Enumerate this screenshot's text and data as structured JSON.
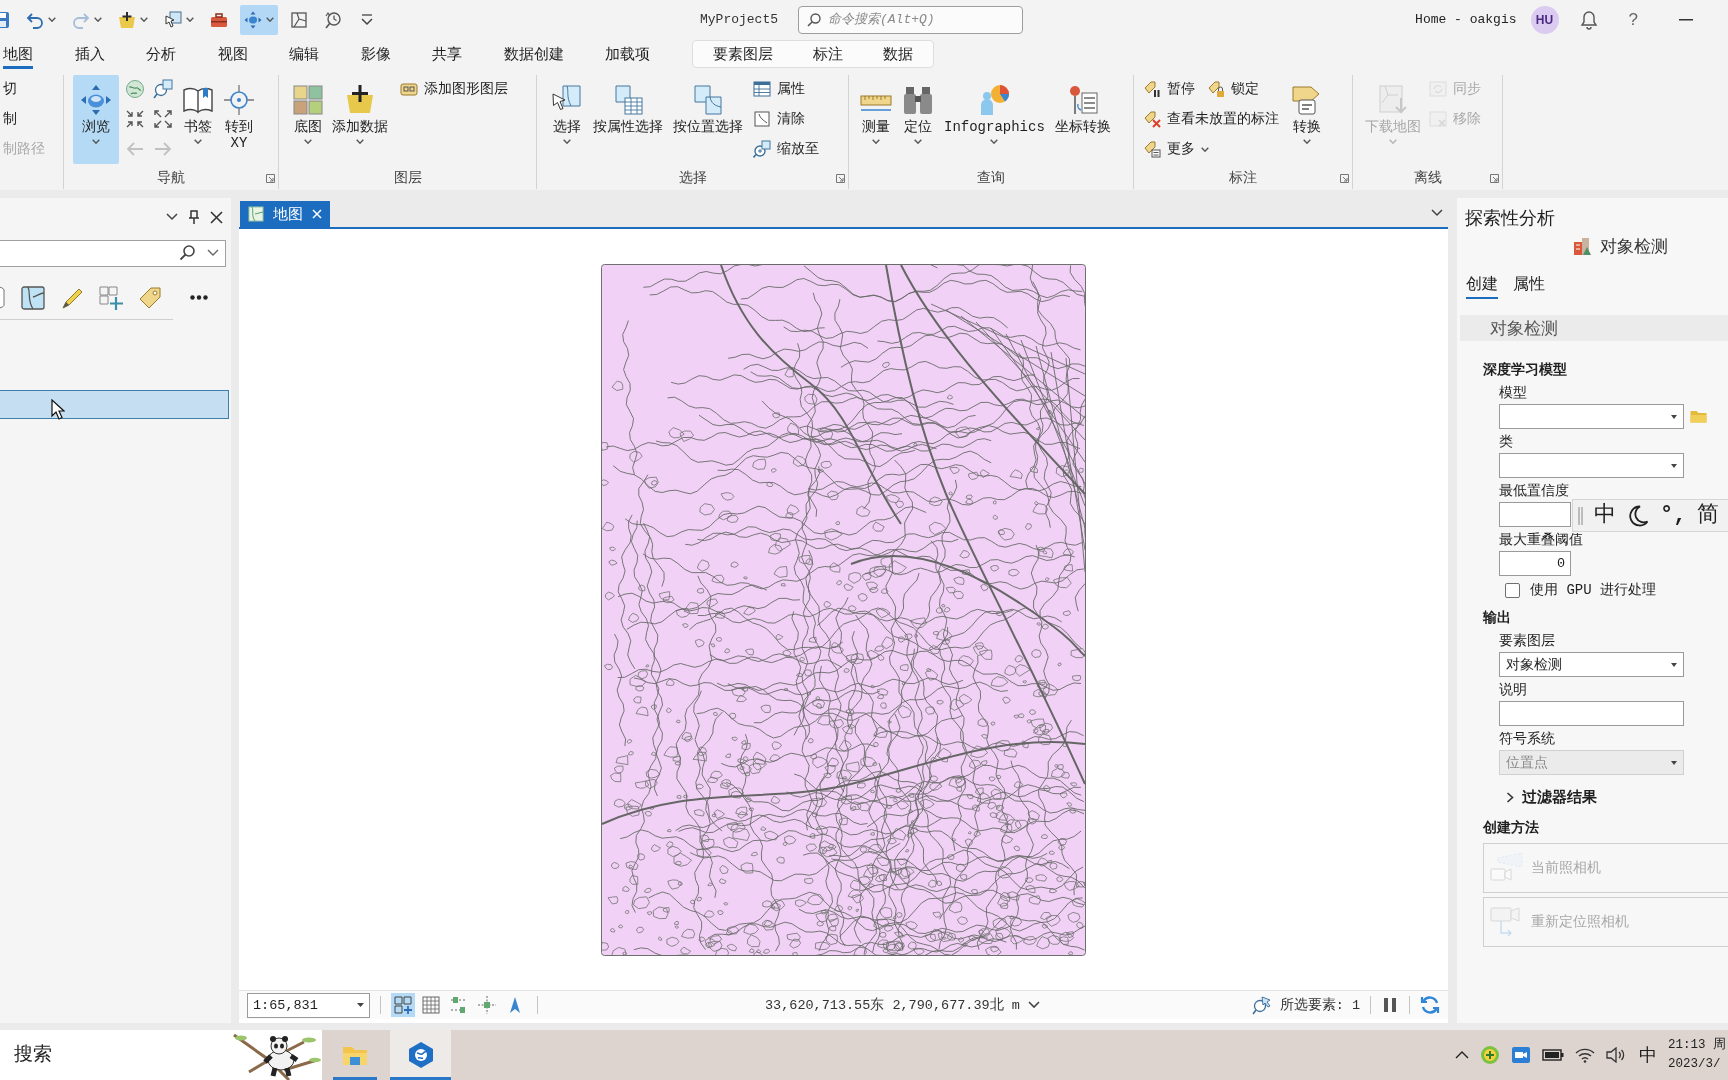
{
  "window": {
    "title": "MyProject5"
  },
  "quick_access": [
    {
      "selected": false,
      "disabled": false,
      "menu": false
    },
    {
      "selected": false,
      "disabled": false,
      "menu": true
    },
    {
      "selected": false,
      "disabled": true,
      "menu": true
    },
    {
      "selected": false,
      "disabled": false,
      "menu": true
    },
    {
      "selected": false,
      "disabled": false,
      "menu": true
    },
    {
      "selected": false,
      "disabled": false,
      "menu": false
    },
    {
      "selected": true,
      "disabled": false,
      "menu": true
    },
    {
      "selected": false,
      "disabled": false,
      "menu": false
    },
    {
      "selected": false,
      "disabled": false,
      "menu": false
    },
    {
      "selected": false,
      "disabled": false,
      "menu": false
    }
  ],
  "command_search": {
    "placeholder": "命令搜索(Alt+Q)"
  },
  "account": {
    "portal": "Home - oakgis",
    "initials": "HU",
    "help": "?"
  },
  "ribbon_tabs": [
    {
      "label": "地图",
      "selected": true
    },
    {
      "label": "插入",
      "selected": false
    },
    {
      "label": "分析",
      "selected": false
    },
    {
      "label": "视图",
      "selected": false
    },
    {
      "label": "编辑",
      "selected": false
    },
    {
      "label": "影像",
      "selected": false
    },
    {
      "label": "共享",
      "selected": false
    },
    {
      "label": "数据创建",
      "selected": false
    },
    {
      "label": "加载项",
      "selected": false
    }
  ],
  "contextual_tabs": [
    {
      "label": "要素图层",
      "selected": false
    },
    {
      "label": "标注",
      "selected": false
    },
    {
      "label": "数据",
      "selected": false
    }
  ],
  "ribbon": {
    "clipboard": [
      {
        "label": "切",
        "disabled": false
      },
      {
        "label": "制",
        "disabled": false
      },
      {
        "label": "制路径",
        "disabled": true
      }
    ],
    "navigate": {
      "label": "导航",
      "explore": {
        "label": "浏览",
        "selected": true
      },
      "tools": [
        {
          "disabled": false
        },
        {
          "disabled": false
        },
        {
          "disabled": false
        },
        {
          "disabled": false
        },
        {
          "disabled": true
        },
        {
          "disabled": true
        }
      ],
      "bookmarks": "书签",
      "go_to_xy": "转到 XY"
    },
    "layer": {
      "label": "图层",
      "basemap": "底图",
      "add_data": "添加数据",
      "add_graphics_layer": "添加图形图层"
    },
    "selection": {
      "label": "选择",
      "large": [
        "选择",
        "按属性选择",
        "按位置选择"
      ],
      "small": [
        "属性",
        "清除",
        "缩放至"
      ]
    },
    "inquiry": {
      "label": "查询",
      "large": [
        "测量",
        "定位",
        "Infographics",
        "坐标转换"
      ]
    },
    "labeling": {
      "label": "标注",
      "small": [
        "暂停",
        "锁定",
        "查看未放置的标注",
        "更多"
      ],
      "convert": "转换"
    },
    "offline": {
      "label": "离线",
      "download": {
        "label": "下载地图",
        "disabled": true
      },
      "small": [
        {
          "label": "同步",
          "disabled": true
        },
        {
          "label": "移除",
          "disabled": true
        }
      ]
    }
  },
  "contents_pane": {
    "rows": [
      {
        "selected": true
      }
    ]
  },
  "map_view": {
    "tab": {
      "label": "地图",
      "selected": true
    },
    "scale": "1:65,831",
    "tools": [
      {
        "selected": true
      },
      {
        "selected": false
      },
      {
        "selected": false
      },
      {
        "selected": false
      },
      {
        "selected": false
      }
    ],
    "coordinates": "33,620,713.55东 2,790,677.39北 m",
    "selection_count": "所选要素: 1"
  },
  "tool_pane": {
    "title": "探索性分析",
    "tool": "对象检测",
    "tabs": [
      {
        "label": "创建",
        "selected": true
      },
      {
        "label": "属性",
        "selected": false
      }
    ],
    "section": "对象检测",
    "groups": [
      {
        "heading": "深度学习模型",
        "fields": [
          {
            "kind": "dropdown",
            "label": "模型",
            "browse": true,
            "disabled": false
          },
          {
            "kind": "dropdown",
            "label": "类",
            "disabled": false
          },
          {
            "kind": "number",
            "label": "最低置信度",
            "disabled": false
          },
          {
            "kind": "number",
            "label": "最大重叠阈值",
            "value": "0",
            "disabled": false
          },
          {
            "kind": "checkbox",
            "label": "使用 GPU 进行处理",
            "checked": false,
            "disabled": false
          }
        ]
      },
      {
        "heading": "输出",
        "fields": [
          {
            "kind": "dropdown",
            "label": "要素图层",
            "value": "对象检测",
            "disabled": false
          },
          {
            "kind": "text",
            "label": "说明",
            "disabled": false
          },
          {
            "kind": "dropdown",
            "label": "符号系统",
            "value": "位置点",
            "disabled": true
          }
        ]
      }
    ],
    "filter": {
      "label": "过滤器结果",
      "expanded": false
    },
    "creation": {
      "heading": "创建方法",
      "methods": [
        {
          "label": "当前照相机",
          "disabled": true
        },
        {
          "label": "重新定位照相机",
          "disabled": true
        }
      ]
    }
  },
  "ime_toolbar": {
    "mode": "中",
    "punctuation": "°,",
    "script": "简"
  },
  "taskbar": {
    "search": {
      "placeholder": "搜索"
    },
    "apps": [
      {
        "running": true,
        "active": false
      },
      {
        "running": true,
        "active": true
      }
    ],
    "language": "中",
    "time": "21:13 周",
    "date": "2023/3/"
  }
}
